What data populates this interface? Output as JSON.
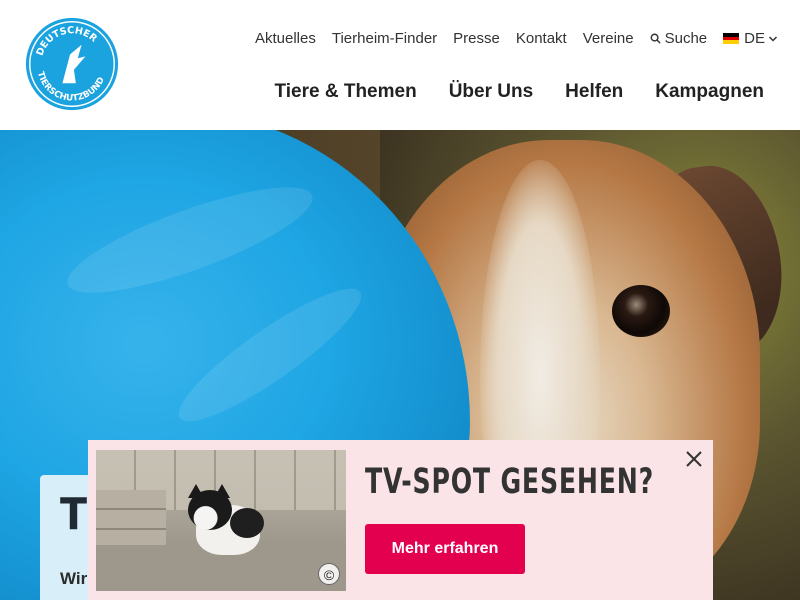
{
  "brand": {
    "logo_text_top": "DEUTSCHER",
    "logo_text_bottom": "TIERSCHUTZBUND",
    "accent_color": "#1aa3df",
    "cta_color": "#e2004f"
  },
  "topnav": {
    "items": [
      "Aktuelles",
      "Tierheim-Finder",
      "Presse",
      "Kontakt",
      "Vereine"
    ],
    "search_label": "Suche",
    "language": "DE"
  },
  "mainnav": {
    "items": [
      "Tiere & Themen",
      "Über Uns",
      "Helfen",
      "Kampagnen"
    ]
  },
  "hero": {
    "card_title": "Ti",
    "card_subtitle": "Wir"
  },
  "popup": {
    "heading": "TV-SPOT GESEHEN?",
    "button_label": "Mehr erfahren",
    "copyright_symbol": "©"
  }
}
